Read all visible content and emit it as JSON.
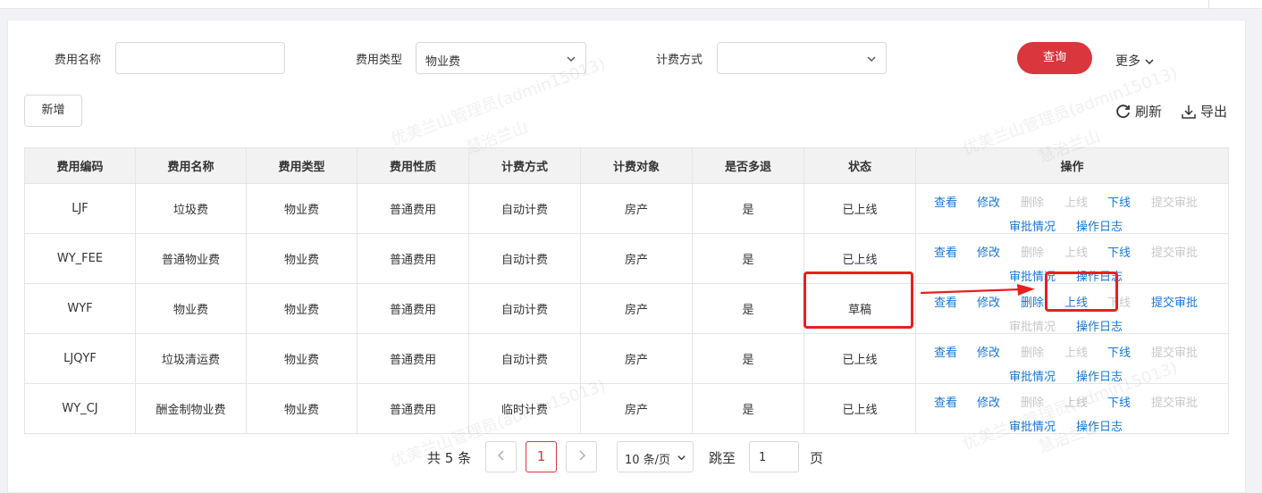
{
  "filters": {
    "fee_name_label": "费用名称",
    "fee_name_value": "",
    "fee_type_label": "费用类型",
    "fee_type_value": "物业费",
    "billing_label": "计费方式",
    "billing_value": ""
  },
  "toolbar": {
    "query_label": "查询",
    "more_label": "更多",
    "add_label": "新增",
    "refresh_label": "刷新",
    "export_label": "导出"
  },
  "table": {
    "headers": [
      "费用编码",
      "费用名称",
      "费用类型",
      "费用性质",
      "计费方式",
      "计费对象",
      "是否多退",
      "状态",
      "操作"
    ],
    "rows": [
      {
        "code": "LJF",
        "name": "垃圾费",
        "type": "物业费",
        "nature": "普通费用",
        "billing": "自动计费",
        "target": "房产",
        "refund": "是",
        "status": "已上线",
        "draft": false
      },
      {
        "code": "WY_FEE",
        "name": "普通物业费",
        "type": "物业费",
        "nature": "普通费用",
        "billing": "自动计费",
        "target": "房产",
        "refund": "是",
        "status": "已上线",
        "draft": false
      },
      {
        "code": "WYF",
        "name": "物业费",
        "type": "物业费",
        "nature": "普通费用",
        "billing": "自动计费",
        "target": "房产",
        "refund": "是",
        "status": "草稿",
        "draft": true
      },
      {
        "code": "LJQYF",
        "name": "垃圾清运费",
        "type": "物业费",
        "nature": "普通费用",
        "billing": "自动计费",
        "target": "房产",
        "refund": "是",
        "status": "已上线",
        "draft": false
      },
      {
        "code": "WY_CJ",
        "name": "酬金制物业费",
        "type": "物业费",
        "nature": "普通费用",
        "billing": "临时计费",
        "target": "房产",
        "refund": "是",
        "status": "已上线",
        "draft": false
      }
    ],
    "actions": {
      "view": "查看",
      "edit": "修改",
      "delete": "删除",
      "online": "上线",
      "offline": "下线",
      "submit": "提交审批",
      "approval": "审批情况",
      "log": "操作日志"
    }
  },
  "pagination": {
    "total_text": "共 5 条",
    "current_page": "1",
    "page_size": "10 条/页",
    "jump_label": "跳至",
    "jump_value": "1",
    "page_suffix": "页"
  },
  "watermark": {
    "text1": "优美兰山管理员(admin15013)",
    "text2": "慧治兰山"
  },
  "colors": {
    "primary": "#d9373d",
    "link": "#1677d9",
    "disabled": "#c8c8c8",
    "highlight": "#e62020"
  }
}
